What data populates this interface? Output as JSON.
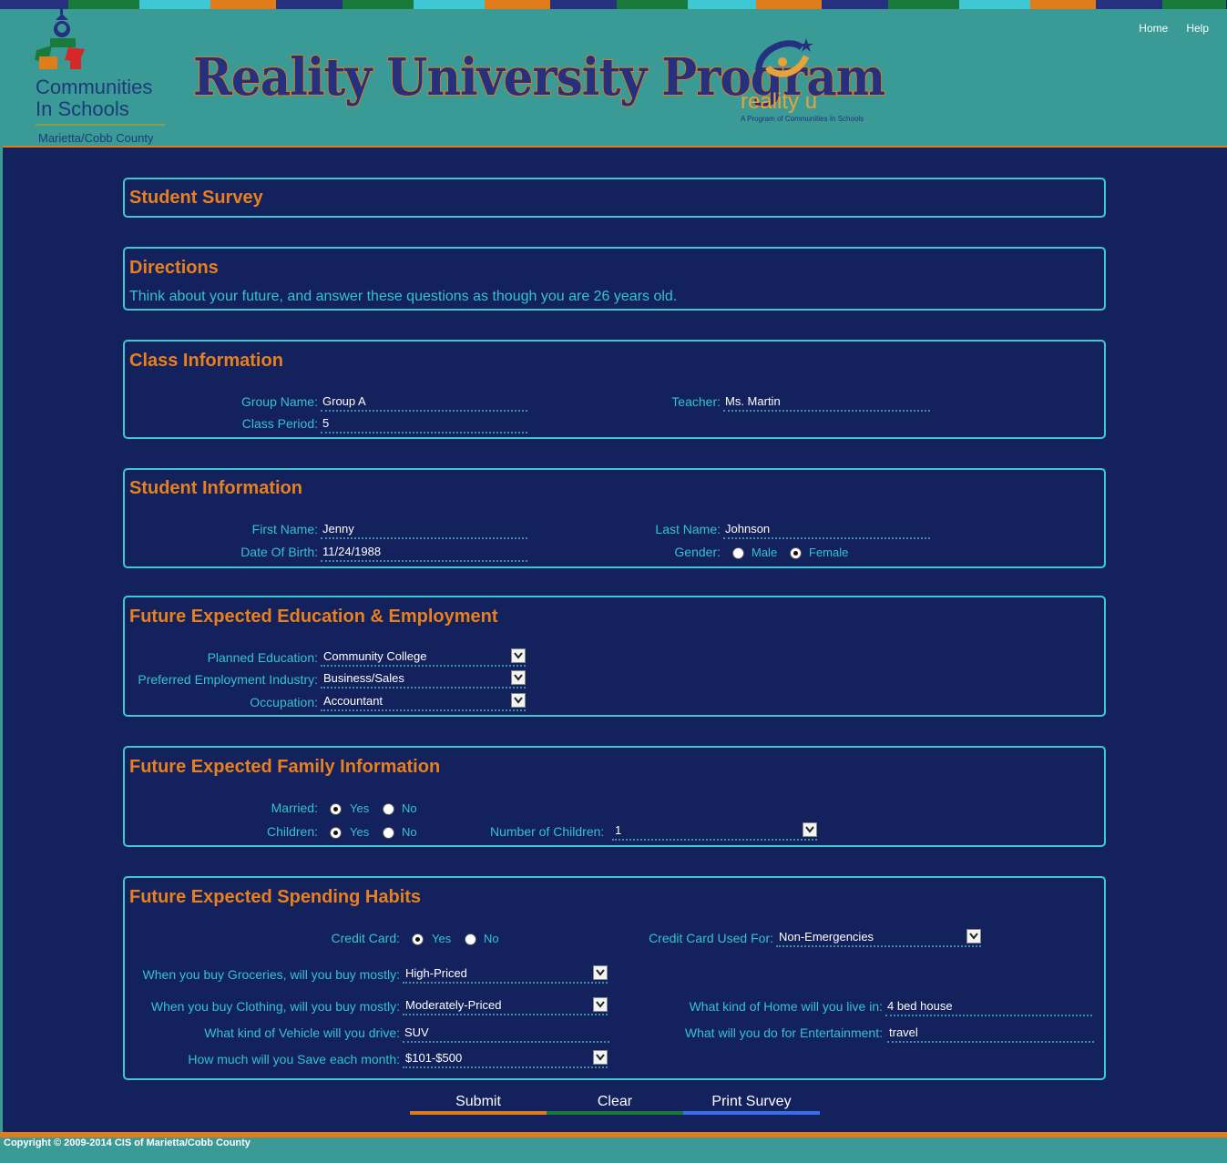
{
  "header": {
    "nav": {
      "home": "Home",
      "help": "Help"
    },
    "cis_logo": {
      "line1": "Communities",
      "line2": "In Schools",
      "sub": "Marietta/Cobb County"
    },
    "title": "Reality University Program",
    "ru_logo": {
      "word": "reality u",
      "sub": "A Program of Communities In Schools"
    }
  },
  "survey": {
    "title": "Student Survey"
  },
  "directions": {
    "title": "Directions",
    "text": "Think about your future, and answer these questions as though you are 26 years old."
  },
  "class_info": {
    "title": "Class Information",
    "group_label": "Group Name:",
    "group_value": "Group A",
    "teacher_label": "Teacher:",
    "teacher_value": "Ms. Martin",
    "period_label": "Class Period:",
    "period_value": "5"
  },
  "student_info": {
    "title": "Student Information",
    "first_label": "First Name:",
    "first_value": "Jenny",
    "last_label": "Last Name:",
    "last_value": "Johnson",
    "dob_label": "Date Of Birth:",
    "dob_value": "11/24/1988",
    "gender_label": "Gender:",
    "male": "Male",
    "female": "Female",
    "gender_selected": "Female"
  },
  "education": {
    "title": "Future Expected Education & Employment",
    "planned_label": "Planned Education:",
    "planned_value": "Community College",
    "industry_label": "Preferred Employment Industry:",
    "industry_value": "Business/Sales",
    "occupation_label": "Occupation:",
    "occupation_value": "Accountant"
  },
  "family": {
    "title": "Future Expected Family Information",
    "married_label": "Married:",
    "children_label": "Children:",
    "yes": "Yes",
    "no": "No",
    "married_selected": "Yes",
    "children_selected": "Yes",
    "num_children_label": "Number of Children:",
    "num_children_value": "1"
  },
  "spending": {
    "title": "Future Expected Spending Habits",
    "credit_label": "Credit Card:",
    "yes": "Yes",
    "no": "No",
    "credit_selected": "Yes",
    "credit_used_label": "Credit Card Used For:",
    "credit_used_value": "Non-Emergencies",
    "groceries_label": "When you buy Groceries, will you buy mostly:",
    "groceries_value": "High-Priced",
    "clothing_label": "When you buy Clothing, will you buy mostly:",
    "clothing_value": "Moderately-Priced",
    "home_label": "What kind of Home will you live in:",
    "home_value": "4 bed house",
    "vehicle_label": "What kind of Vehicle will you drive:",
    "vehicle_value": "SUV",
    "entertainment_label": "What will you do for Entertainment:",
    "entertainment_value": "travel",
    "save_label": "How much will you Save each month:",
    "save_value": "$101-$500"
  },
  "buttons": {
    "submit": "Submit",
    "clear": "Clear",
    "print": "Print Survey"
  },
  "footer": {
    "copyright": "Copyright © 2009-2014 CIS of Marietta/Cobb County"
  },
  "colors": {
    "accent_orange": "#e07d1a",
    "teal": "#3a9b96",
    "navy": "#13215c",
    "cyan_text": "#35c3cf"
  }
}
